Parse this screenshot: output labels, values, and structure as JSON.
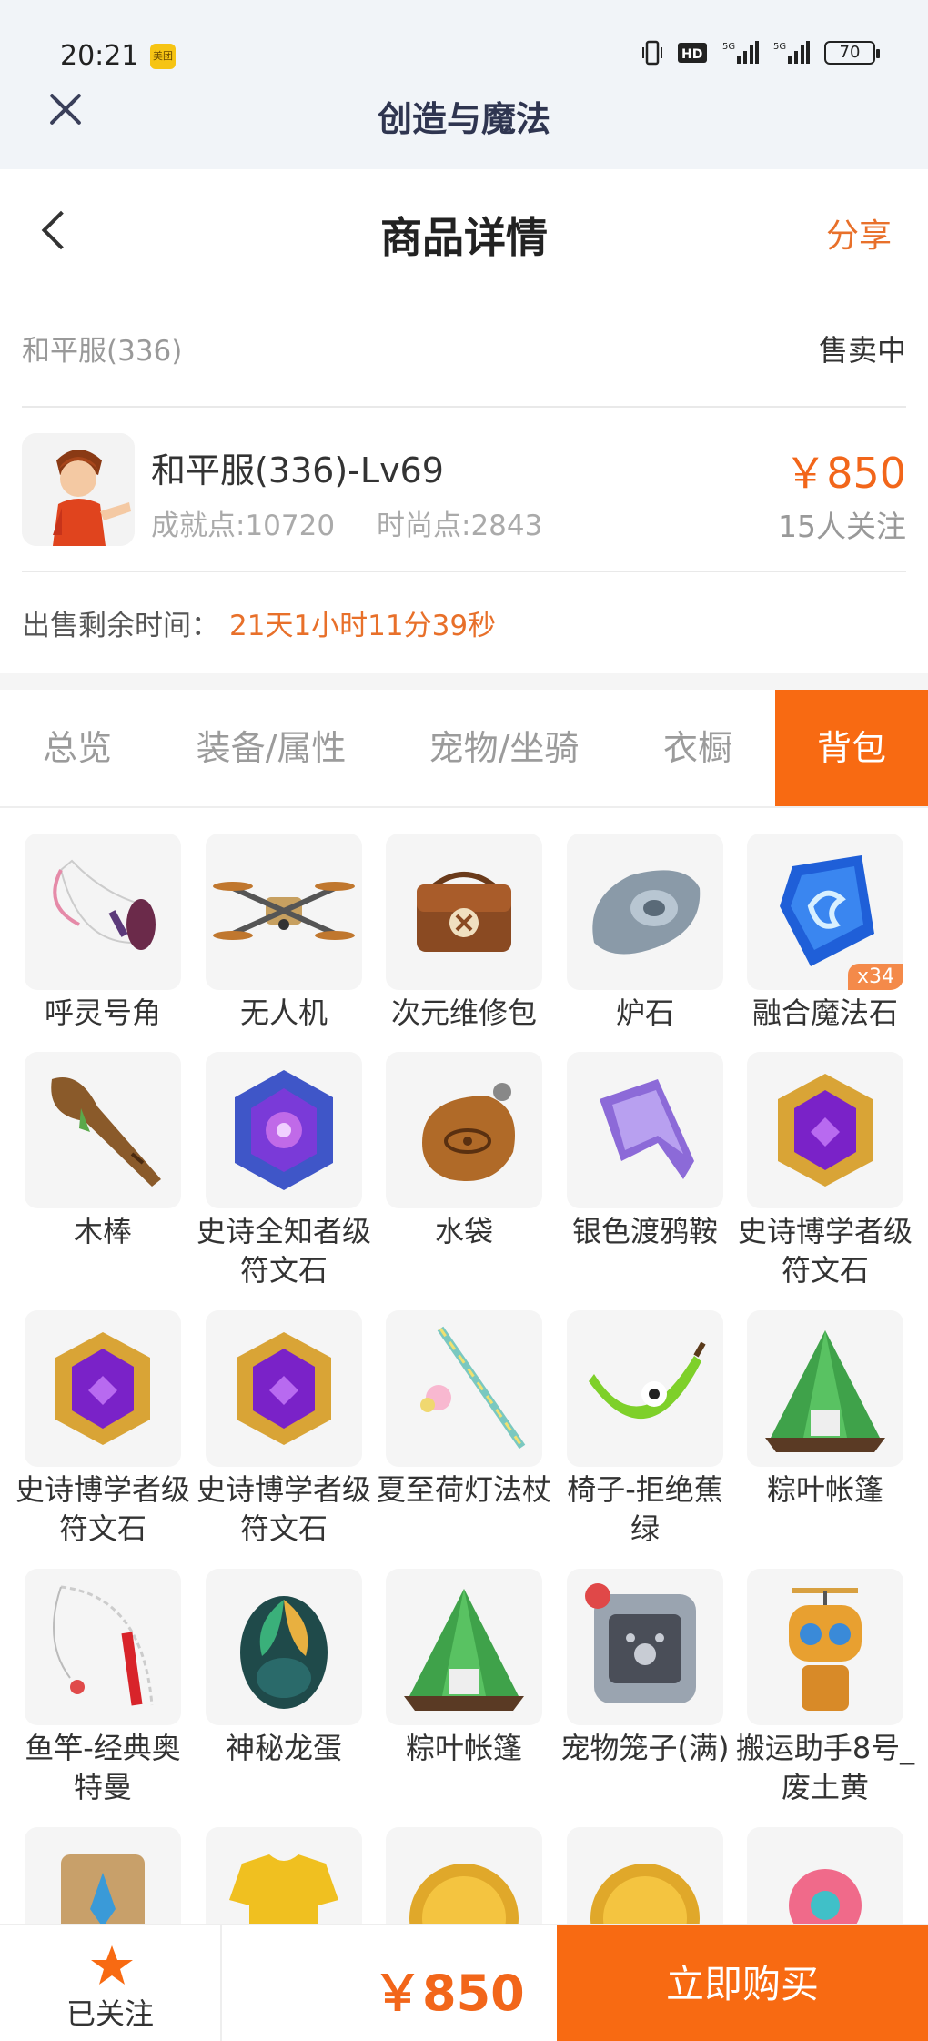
{
  "status_bar": {
    "time": "20:21",
    "app_badge": "美团",
    "battery": "70"
  },
  "app_bar": {
    "title": "创造与魔法"
  },
  "header": {
    "title": "商品详情",
    "share": "分享"
  },
  "listing": {
    "server": "和平服(336)",
    "status": "售卖中",
    "character": "和平服(336)-Lv69",
    "achievement": "成就点:10720",
    "fashion": "时尚点:2843",
    "price": "￥850",
    "followers": "15人关注",
    "remain_label": "出售剩余时间：",
    "remain_value": "21天1小时11分39秒"
  },
  "tabs": [
    {
      "label": "总览"
    },
    {
      "label": "装备/属性"
    },
    {
      "label": "宠物/坐骑"
    },
    {
      "label": "衣橱"
    },
    {
      "label": "背包"
    }
  ],
  "items": [
    {
      "name": "呼灵号角",
      "icon": "horn-icon"
    },
    {
      "name": "无人机",
      "icon": "drone-icon"
    },
    {
      "name": "次元维修包",
      "icon": "repair-bag-icon"
    },
    {
      "name": "炉石",
      "icon": "hearthstone-icon"
    },
    {
      "name": "融合魔法石",
      "icon": "magic-stone-icon",
      "qty": "x34"
    },
    {
      "name": "木棒",
      "icon": "club-icon"
    },
    {
      "name": "史诗全知者级符文石",
      "icon": "rune-stone-icon"
    },
    {
      "name": "水袋",
      "icon": "water-bag-icon"
    },
    {
      "name": "银色渡鸦鞍",
      "icon": "saddle-icon"
    },
    {
      "name": "史诗博学者级符文石",
      "icon": "rune-stone-icon"
    },
    {
      "name": "史诗博学者级符文石",
      "icon": "rune-stone-icon"
    },
    {
      "name": "史诗博学者级符文石",
      "icon": "rune-stone-icon"
    },
    {
      "name": "夏至荷灯法杖",
      "icon": "staff-icon"
    },
    {
      "name": "椅子-拒绝蕉绿",
      "icon": "banana-chair-icon"
    },
    {
      "name": "粽叶帐篷",
      "icon": "tent-icon"
    },
    {
      "name": "鱼竿-经典奥特曼",
      "icon": "fishing-rod-icon"
    },
    {
      "name": "神秘龙蛋",
      "icon": "dragon-egg-icon"
    },
    {
      "name": "粽叶帐篷",
      "icon": "tent-icon"
    },
    {
      "name": "宠物笼子(满)",
      "icon": "pet-cage-icon"
    },
    {
      "name": "搬运助手8号_废土黄",
      "icon": "robot-icon"
    },
    {
      "name": "",
      "icon": "scroll-icon"
    },
    {
      "name": "",
      "icon": "shirt-icon"
    },
    {
      "name": "",
      "icon": "coin-icon"
    },
    {
      "name": "",
      "icon": "coin-icon"
    },
    {
      "name": "",
      "icon": "flower-icon"
    }
  ],
  "bottom_bar": {
    "follow_label": "已关注",
    "price": "￥850",
    "buy": "立即购买"
  },
  "colors": {
    "accent": "#f86a12",
    "price": "#f2661a"
  }
}
